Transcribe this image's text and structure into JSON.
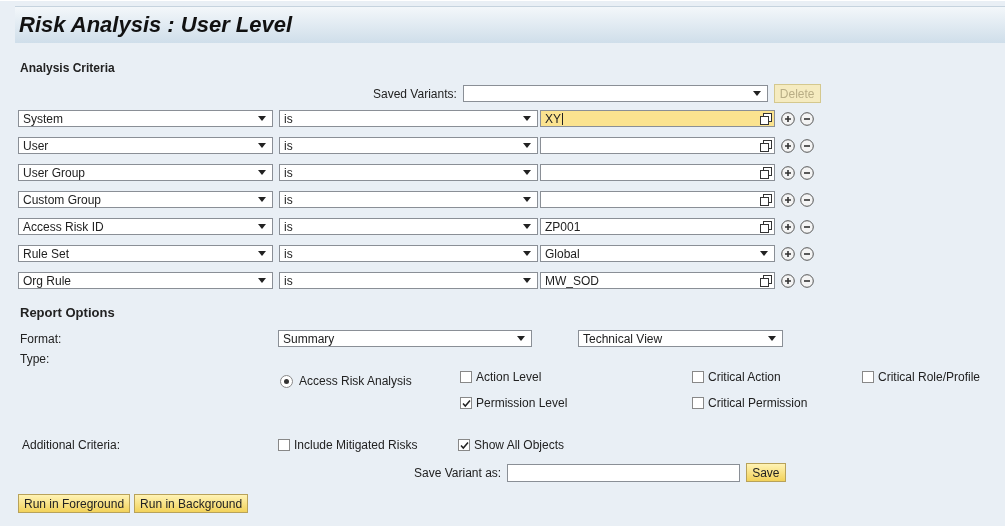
{
  "title": "Risk Analysis : User Level",
  "analysis_criteria": {
    "heading": "Analysis Criteria",
    "saved_variants": {
      "label": "Saved Variants:",
      "delete_button": {
        "label": "Delete",
        "disabled": true
      }
    },
    "rows": [
      {
        "kind": "input",
        "field": "System",
        "operator": "is",
        "value": "XY",
        "focused": true
      },
      {
        "kind": "input",
        "field": "User",
        "operator": "is",
        "focused": false
      },
      {
        "kind": "input",
        "field": "User Group",
        "operator": "is",
        "focused": false
      },
      {
        "kind": "input",
        "field": "Custom Group",
        "operator": "is",
        "focused": false
      },
      {
        "kind": "input",
        "field": "Access Risk ID",
        "operator": "is",
        "value": "ZP001",
        "focused": false
      },
      {
        "kind": "dropdown",
        "field": "Rule Set",
        "operator": "is",
        "value": "Global",
        "focused": false
      },
      {
        "kind": "input",
        "field": "Org Rule",
        "operator": "is",
        "value": "MW_SOD",
        "focused": false
      }
    ]
  },
  "report_options": {
    "heading": "Report Options",
    "format_label": "Format:",
    "format": "Summary",
    "view": "Technical View",
    "type_label": "Type:",
    "radio": {
      "label": "Access Risk Analysis",
      "selected": true
    },
    "checkbox_columns": [
      [
        {
          "label": "Action Level",
          "checked": false
        },
        {
          "label": "Permission Level",
          "checked": true
        }
      ],
      [
        {
          "label": "Critical Action",
          "checked": false
        },
        {
          "label": "Critical Permission",
          "checked": false
        }
      ],
      [
        {
          "label": "Critical Role/Profile",
          "checked": false
        }
      ]
    ],
    "additional_label": "Additional Criteria:",
    "additional": [
      {
        "label": "Include Mitigated Risks",
        "checked": false
      },
      {
        "label": "Show All Objects",
        "checked": true
      }
    ],
    "save_variant_label": "Save Variant as:",
    "save_button": "Save"
  },
  "buttons": [
    "Run in Foreground",
    "Run in Background"
  ]
}
